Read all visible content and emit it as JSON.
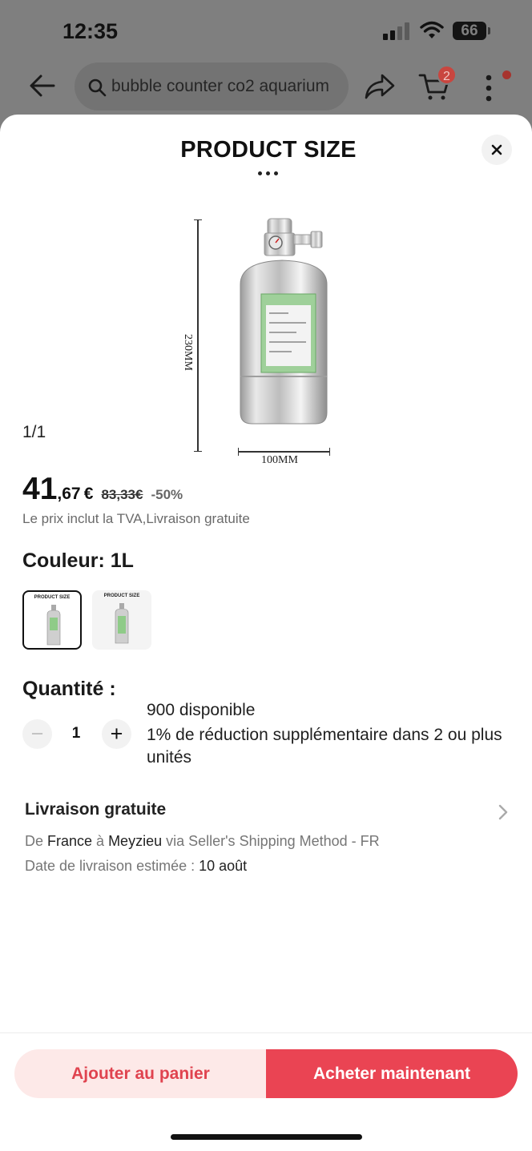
{
  "status": {
    "time": "12:35",
    "battery": "66"
  },
  "topbar": {
    "search_text": "bubble counter co2 aquarium",
    "cart_count": "2"
  },
  "product_image": {
    "title": "PRODUCT SIZE",
    "height_label": "230MM",
    "width_label": "100MM",
    "counter": "1/1"
  },
  "price": {
    "integer": "41",
    "decimal": ",67 €",
    "original": "83,33€",
    "discount": "-50%",
    "tax_note": "Le prix inclut la TVA,Livraison gratuite"
  },
  "color": {
    "label": "Couleur: 1L",
    "options": [
      {
        "title": "PRODUCT SIZE",
        "selected": true
      },
      {
        "title": "PRODUCT SIZE",
        "selected": false
      }
    ]
  },
  "quantity": {
    "label": "Quantité :",
    "value": "1",
    "minus": "−",
    "plus": "+",
    "stock": "900 disponible",
    "bulk_offer": "1% de réduction supplémentaire dans 2 ou plus unités"
  },
  "shipping": {
    "title": "Livraison gratuite",
    "from_word": "De ",
    "from": "France",
    "to_word": " à ",
    "to": "Meyzieu",
    "method": " via Seller's Shipping Method - FR",
    "date_label": "Date de livraison estimée : ",
    "date": "10 août"
  },
  "actions": {
    "add_to_cart": "Ajouter au panier",
    "buy_now": "Acheter maintenant"
  },
  "colors": {
    "accent": "#ea4453",
    "accent_light": "#fde9e8"
  }
}
